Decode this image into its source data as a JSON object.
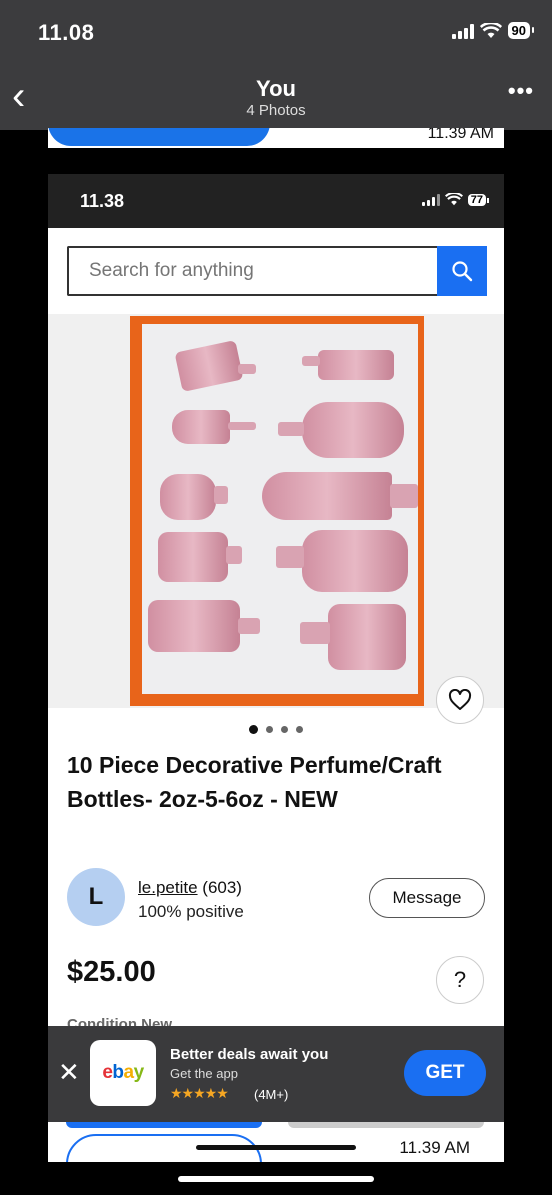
{
  "outer_status": {
    "time": "11.08",
    "battery": "90"
  },
  "outer_nav": {
    "title": "You",
    "subtitle": "4 Photos"
  },
  "prev_fragment": {
    "time": "11.39 AM"
  },
  "inner_status": {
    "time": "11.38",
    "battery": "77"
  },
  "search": {
    "placeholder": "Search for anything"
  },
  "listing": {
    "photo_count": 4,
    "active_photo": 1,
    "title": "10 Piece Decorative Perfume/Craft Bottles- 2oz-5-6oz - NEW",
    "seller_initial": "L",
    "seller_name": "le.petite",
    "seller_feedback": "(603)",
    "seller_positive": "100% positive",
    "message_label": "Message",
    "price": "$25.00",
    "help_label": "?",
    "condition_label": "Condition New"
  },
  "app_banner": {
    "app_name": "ebay",
    "headline": "Better deals await you",
    "subtext": "Get the app",
    "stars": "★★★★★",
    "rating_count": "(4M+)",
    "get_label": "GET"
  },
  "next_fragment": {
    "time": "11.39 AM"
  },
  "colors": {
    "ebay_blue": "#1a6ff2",
    "bottle_pink": "#d996a8",
    "box_orange": "#e8641a"
  }
}
